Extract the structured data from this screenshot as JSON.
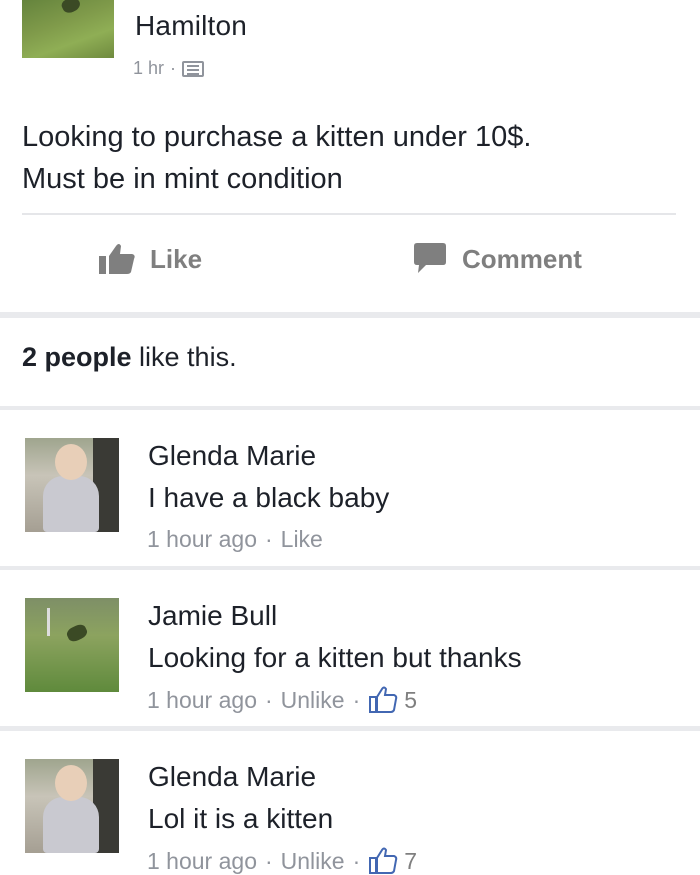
{
  "post": {
    "author": "Hamilton",
    "time": "1 hr",
    "dot": "·",
    "audience_icon": "group-audience-icon",
    "text_line1": "Looking to purchase a kitten under 10$.",
    "text_line2": "Must be in mint condition"
  },
  "actions": {
    "like_label": "Like",
    "comment_label": "Comment",
    "like_icon": "thumbs-up-icon",
    "comment_icon": "speech-bubble-icon"
  },
  "likes_summary": {
    "count_text": "2 people",
    "suffix": " like this."
  },
  "comments": [
    {
      "name": "Glenda Marie",
      "text": "I have a black baby",
      "time": "1 hour ago",
      "action": "Like",
      "likes": ""
    },
    {
      "name": "Jamie Bull",
      "text": "Looking for a kitten but thanks",
      "time": "1 hour ago",
      "action": "Unlike",
      "likes": "5"
    },
    {
      "name": "Glenda Marie",
      "text": "Lol it is a kitten",
      "time": "1 hour ago",
      "action": "Unlike",
      "likes": "7"
    }
  ],
  "colors": {
    "text_primary": "#1d2129",
    "text_meta": "#90949c",
    "action_gray": "#7f7f7f",
    "page_bg": "#e9eaed"
  }
}
